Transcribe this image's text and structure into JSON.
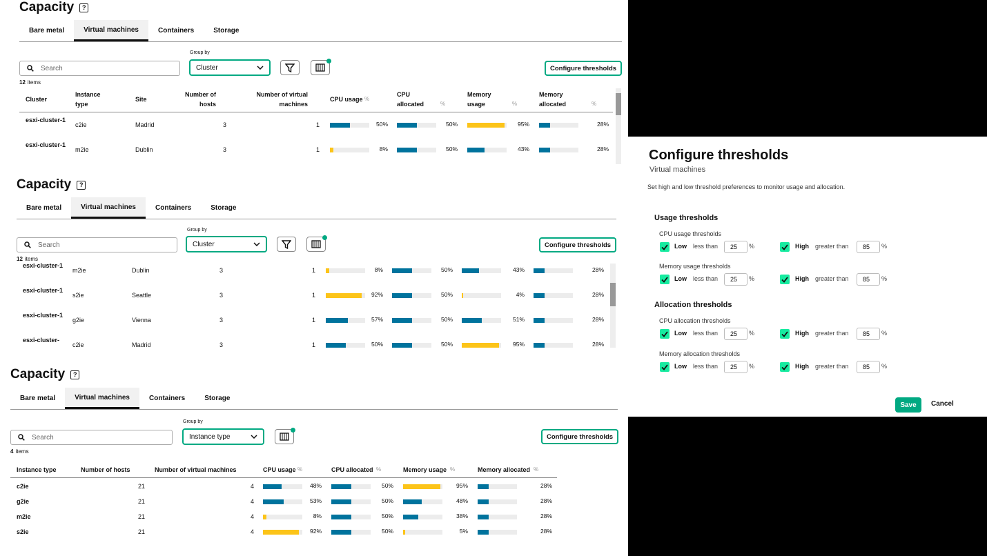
{
  "colors": {
    "accent": "#01a982",
    "bar_blue": "#00739d",
    "bar_yellow": "#fcc419",
    "track": "#ececec"
  },
  "panel1": {
    "title": "Capacity",
    "tabs": [
      "Bare metal",
      "Virtual machines",
      "Containers",
      "Storage"
    ],
    "active_tab": "Virtual machines",
    "search_placeholder": "Search",
    "group_by_label": "Group by",
    "group_by_value": "Cluster",
    "configure_label": "Configure thresholds",
    "item_count": "12",
    "items_label": "items",
    "headers": [
      "Cluster",
      "Instance type",
      "Site",
      "Number of hosts",
      "Number of virtual machines",
      "CPU usage",
      "CPU allocated",
      "Memory usage",
      "Memory allocated"
    ],
    "rows": [
      {
        "cluster": "esxi-cluster-1",
        "type": "c2ie",
        "site": "Madrid",
        "hosts": "3",
        "vms": "1",
        "cpu": 50,
        "cpu_alloc": 50,
        "mem": 95,
        "mem_alloc": 28
      },
      {
        "cluster": "esxi-cluster-1",
        "type": "m2ie",
        "site": "Dublin",
        "hosts": "3",
        "vms": "1",
        "cpu": 8,
        "cpu_alloc": 50,
        "mem": 43,
        "mem_alloc": 28
      }
    ]
  },
  "panel2": {
    "title": "Capacity",
    "tabs": [
      "Bare metal",
      "Virtual machines",
      "Containers",
      "Storage"
    ],
    "active_tab": "Virtual machines",
    "search_placeholder": "Search",
    "group_by_label": "Group by",
    "group_by_value": "Cluster",
    "configure_label": "Configure thresholds",
    "item_count": "12",
    "items_label": "items",
    "rows": [
      {
        "cluster": "esxi-cluster-1",
        "type": "m2ie",
        "site": "Dublin",
        "hosts": "3",
        "vms": "1",
        "cpu": 8,
        "cpu_alloc": 50,
        "mem": 43,
        "mem_alloc": 28
      },
      {
        "cluster": "esxi-cluster-1",
        "type": "s2ie",
        "site": "Seattle",
        "hosts": "3",
        "vms": "1",
        "cpu": 92,
        "cpu_alloc": 50,
        "mem": 4,
        "mem_alloc": 28
      },
      {
        "cluster": "esxi-cluster-1",
        "type": "g2ie",
        "site": "Vienna",
        "hosts": "3",
        "vms": "1",
        "cpu": 57,
        "cpu_alloc": 50,
        "mem": 51,
        "mem_alloc": 28
      },
      {
        "cluster": "esxi-cluster-",
        "type": "c2ie",
        "site": "Madrid",
        "hosts": "3",
        "vms": "1",
        "cpu": 50,
        "cpu_alloc": 50,
        "mem": 95,
        "mem_alloc": 28
      }
    ]
  },
  "panel3": {
    "title": "Capacity",
    "tabs": [
      "Bare metal",
      "Virtual machines",
      "Containers",
      "Storage"
    ],
    "active_tab": "Virtual machines",
    "search_placeholder": "Search",
    "group_by_label": "Group by",
    "group_by_value": "Instance type",
    "configure_label": "Configure thresholds",
    "item_count": "4",
    "items_label": "items",
    "headers": [
      "Instance type",
      "Number of hosts",
      "Number of virtual machines",
      "CPU usage",
      "CPU allocated",
      "Memory usage",
      "Memory allocated"
    ],
    "rows": [
      {
        "type": "c2ie",
        "hosts": "21",
        "vms": "4",
        "cpu": 48,
        "cpu_alloc": 50,
        "mem": 95,
        "mem_alloc": 28
      },
      {
        "type": "g2ie",
        "hosts": "21",
        "vms": "4",
        "cpu": 53,
        "cpu_alloc": 50,
        "mem": 48,
        "mem_alloc": 28
      },
      {
        "type": "m2ie",
        "hosts": "21",
        "vms": "4",
        "cpu": 8,
        "cpu_alloc": 50,
        "mem": 38,
        "mem_alloc": 28
      },
      {
        "type": "s2ie",
        "hosts": "21",
        "vms": "4",
        "cpu": 92,
        "cpu_alloc": 50,
        "mem": 5,
        "mem_alloc": 28
      }
    ]
  },
  "dialog": {
    "title": "Configure thresholds",
    "subtitle": "Virtual machines",
    "description": "Set high and low threshold preferences to monitor usage and allocation.",
    "usage_heading": "Usage thresholds",
    "allocation_heading": "Allocation thresholds",
    "groups": [
      {
        "label": "CPU usage thresholds",
        "low": "25",
        "high": "85"
      },
      {
        "label": "Memory usage thresholds",
        "low": "25",
        "high": "85"
      },
      {
        "label": "CPU allocation thresholds",
        "low": "25",
        "high": "85"
      },
      {
        "label": "Memory allocation thresholds",
        "low": "25",
        "high": "85"
      }
    ],
    "low_label": "Low",
    "less_than": "less than",
    "high_label": "High",
    "greater_than": "greater than",
    "percent": "%",
    "save_label": "Save",
    "cancel_label": "Cancel"
  }
}
